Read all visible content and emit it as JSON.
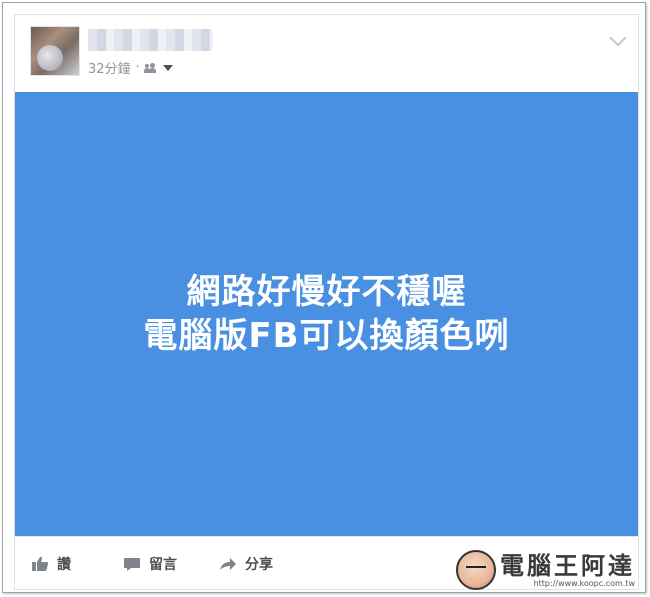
{
  "post": {
    "time": "32分鐘",
    "separator": "·",
    "privacy_icon": "friends-icon",
    "options_icon": "chevron-down-icon",
    "image": {
      "background_color": "#4a90e2",
      "lines": [
        "網路好慢好不穩喔",
        "電腦版FB可以換顏色咧"
      ]
    }
  },
  "actions": {
    "like_label": "讚",
    "comment_label": "留言",
    "share_label": "分享"
  },
  "watermark": {
    "title": "電腦王阿達",
    "url": "http://www.koopc.com.tw"
  },
  "colors": {
    "meta_text": "#90949c",
    "action_text": "#4b4f56",
    "post_background": "#4a90e2"
  }
}
